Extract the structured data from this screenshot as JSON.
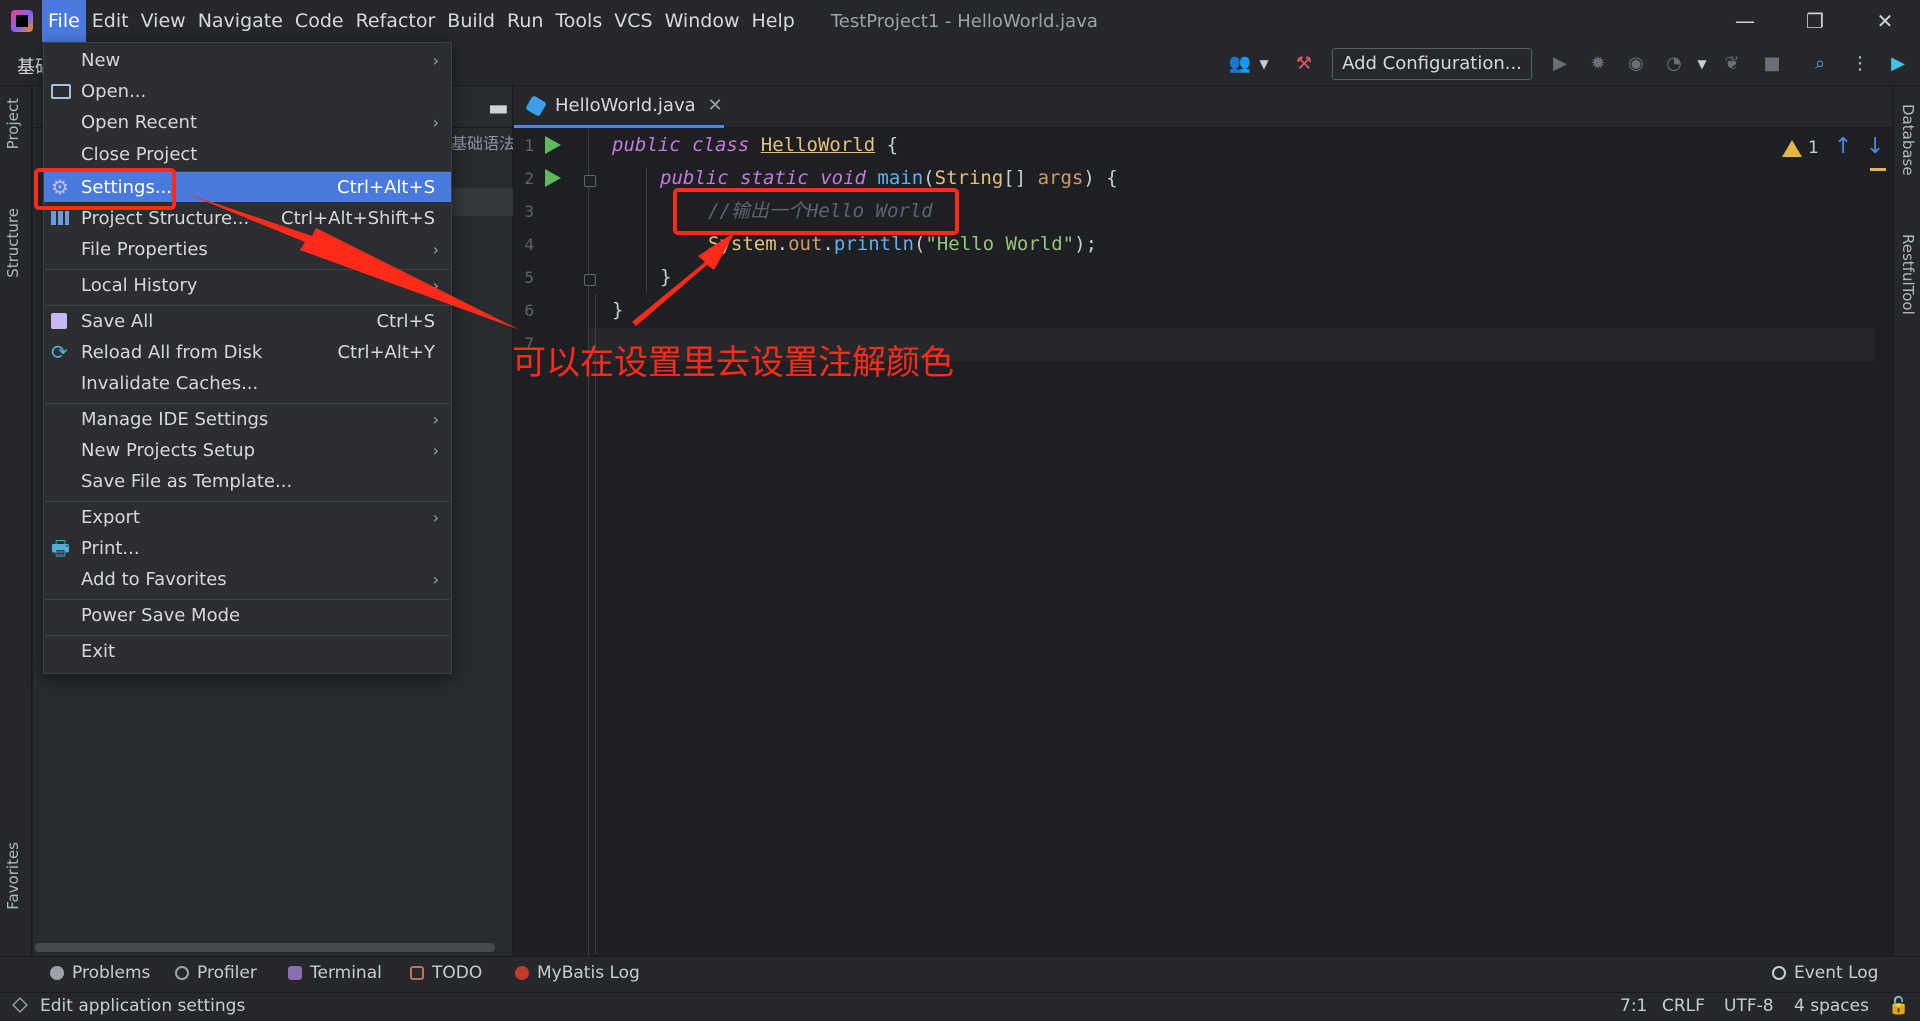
{
  "titlebar": {
    "menus": [
      "File",
      "Edit",
      "View",
      "Navigate",
      "Code",
      "Refactor",
      "Build",
      "Run",
      "Tools",
      "VCS",
      "Window",
      "Help"
    ],
    "window_title": "TestProject1 - HelloWorld.java",
    "controls": [
      "minimize",
      "restore",
      "close"
    ]
  },
  "navbar": {
    "breadcrumb": "基础",
    "add_configuration": "Add Configuration..."
  },
  "left_tabs": {
    "project": "Project",
    "structure": "Structure",
    "favorites": "Favorites"
  },
  "project_panel": {
    "crumb": "基础语法"
  },
  "right_tabs": {
    "database": "Database",
    "restful": "RestfulTool"
  },
  "editor": {
    "tab": "HelloWorld.java",
    "line_numbers": [
      "1",
      "2",
      "3",
      "4",
      "5",
      "6",
      "7"
    ],
    "warning_count": "1",
    "code": {
      "l1_kw1": "public",
      "l1_kw2": "class",
      "l1_name": "HelloWorld",
      "l1_brace": " {",
      "l2_kw1": "public",
      "l2_kw2": "static",
      "l2_kw3": "void",
      "l2_fn": "main",
      "l2_p1": "(",
      "l2_type": "String",
      "l2_p2": "[] ",
      "l2_arg": "args",
      "l2_p3": ") {",
      "l3_comment": "//输出一个Hello World",
      "l4_obj": "System",
      "l4_dot1": ".",
      "l4_field": "out",
      "l4_dot2": ".",
      "l4_fn": "println",
      "l4_p1": "(",
      "l4_str": "\"Hello World\"",
      "l4_p2": ");",
      "l5": "}",
      "l6": "}"
    }
  },
  "file_menu": {
    "items": [
      {
        "label": "New",
        "shortcut": "",
        "submenu": true
      },
      {
        "label": "Open...",
        "shortcut": "",
        "submenu": false
      },
      {
        "label": "Open Recent",
        "shortcut": "",
        "submenu": true
      },
      {
        "label": "Close Project",
        "shortcut": "",
        "submenu": false
      },
      {
        "label": "Settings...",
        "shortcut": "Ctrl+Alt+S",
        "submenu": false
      },
      {
        "label": "Project Structure...",
        "shortcut": "Ctrl+Alt+Shift+S",
        "submenu": false
      },
      {
        "label": "File Properties",
        "shortcut": "",
        "submenu": true
      },
      {
        "label": "Local History",
        "shortcut": "",
        "submenu": true
      },
      {
        "label": "Save All",
        "shortcut": "Ctrl+S",
        "submenu": false
      },
      {
        "label": "Reload All from Disk",
        "shortcut": "Ctrl+Alt+Y",
        "submenu": false
      },
      {
        "label": "Invalidate Caches...",
        "shortcut": "",
        "submenu": false
      },
      {
        "label": "Manage IDE Settings",
        "shortcut": "",
        "submenu": true
      },
      {
        "label": "New Projects Setup",
        "shortcut": "",
        "submenu": true
      },
      {
        "label": "Save File as Template...",
        "shortcut": "",
        "submenu": false
      },
      {
        "label": "Export",
        "shortcut": "",
        "submenu": true
      },
      {
        "label": "Print...",
        "shortcut": "",
        "submenu": false
      },
      {
        "label": "Add to Favorites",
        "shortcut": "",
        "submenu": true
      },
      {
        "label": "Power Save Mode",
        "shortcut": "",
        "submenu": false
      },
      {
        "label": "Exit",
        "shortcut": "",
        "submenu": false
      }
    ],
    "selected": "Settings..."
  },
  "annotation": {
    "text": "可以在设置里去设置注解颜色"
  },
  "toolwindows": [
    "Problems",
    "Profiler",
    "Terminal",
    "TODO",
    "MyBatis Log"
  ],
  "event_log": "Event Log",
  "statusbar": {
    "message": "Edit application settings",
    "position": "7:1",
    "line_sep": "CRLF",
    "encoding": "UTF-8",
    "indent": "4 spaces"
  },
  "colors": {
    "accent": "#4a7ade",
    "annotation_red": "#ff2a1a",
    "run_green": "#5fb85c",
    "warning_yellow": "#e6b64a"
  }
}
